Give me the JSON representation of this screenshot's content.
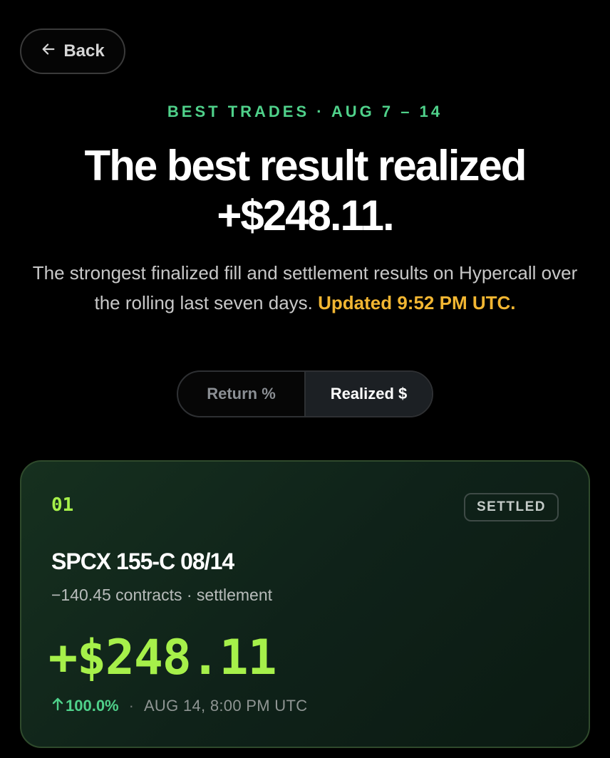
{
  "nav": {
    "back_label": "Back"
  },
  "header": {
    "eyebrow": "BEST TRADES · AUG 7 – 14",
    "headline_line1": "The best result realized",
    "headline_line2": "+$248.11.",
    "subtitle": "The strongest finalized fill and settlement results on Hypercall over the rolling last seven days.",
    "updated": "Updated 9:52 PM UTC."
  },
  "toggle": {
    "options": [
      "Return %",
      "Realized $"
    ],
    "selected": "Realized $"
  },
  "trades": [
    {
      "rank": "01",
      "status": "SETTLED",
      "contract": "SPCX 155-C 08/14",
      "meta": "−140.45 contracts · settlement",
      "pnl": "+$248.11",
      "return": "100.0%",
      "separator": "·",
      "timestamp": "AUG 14, 8:00 PM UTC"
    }
  ],
  "colors": {
    "accent_green": "#4fd18a",
    "pnl_green": "#a6f04a",
    "updated_yellow": "#f2b632",
    "background": "#000000"
  },
  "icons": {
    "back": "arrow-left-icon",
    "return": "arrow-up-icon"
  }
}
